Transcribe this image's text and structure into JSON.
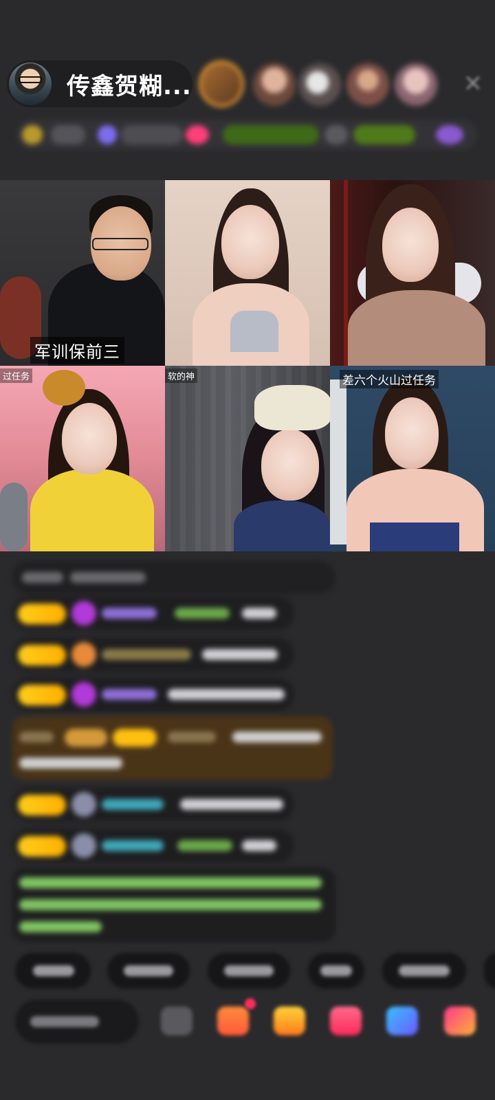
{
  "host": {
    "name": "传鑫贺糊..."
  },
  "video_grid": {
    "tiles": [
      {
        "caption": "军训保前三"
      },
      {
        "caption": ""
      },
      {
        "caption": ""
      },
      {
        "caption": "过任务"
      },
      {
        "caption": "软的神"
      },
      {
        "caption": "差六个火山过任务"
      }
    ]
  },
  "icons": {
    "close": "close-icon",
    "gift": "gift-icon",
    "emoji": "emoji-icon",
    "share": "share-icon"
  },
  "colors": {
    "background": "#2a2a2c",
    "level_badge": "#ffbf10",
    "accent_pink": "#ff3e7a",
    "chat_username_green": "#8ad06a",
    "gift_banner": "#4a3418"
  }
}
